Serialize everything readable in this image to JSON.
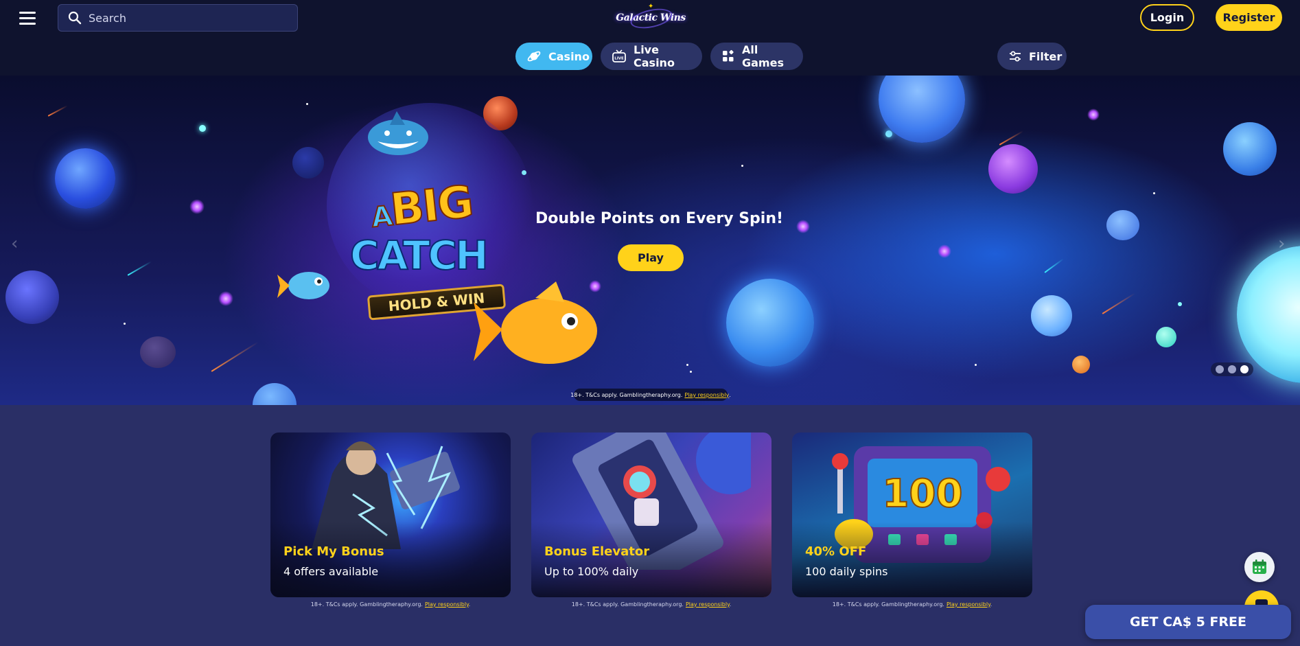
{
  "header": {
    "search_placeholder": "Search",
    "logo_text": "Galactic Wins",
    "login_label": "Login",
    "register_label": "Register"
  },
  "tabs": [
    {
      "label": "Casino",
      "icon": "planet-icon",
      "active": true
    },
    {
      "label": "Live Casino",
      "icon": "live-tv-icon",
      "active": false
    },
    {
      "label": "All Games",
      "icon": "grid-icon",
      "active": false
    }
  ],
  "filter_label": "Filter",
  "hero": {
    "game_logo_big": "BIG",
    "game_logo_a": "A",
    "game_logo_catch": "CATCH",
    "game_logo_hold": "HOLD & WIN",
    "title": "Double Points on Every Spin!",
    "play_label": "Play",
    "disclaimer": "18+. T&Cs apply. Gamblingtheraphy.org.",
    "disclaimer_link": "Play responsibly",
    "slides": 3,
    "active_slide": 3
  },
  "promos": [
    {
      "title": "Pick My Bonus",
      "subtitle": "4 offers available",
      "disclaimer": "18+. T&Cs apply. Gamblingtheraphy.org.",
      "disclaimer_link": "Play responsibly"
    },
    {
      "title": "Bonus Elevator",
      "subtitle": "Up to 100% daily",
      "disclaimer": "18+. T&Cs apply. Gamblingtheraphy.org.",
      "disclaimer_link": "Play responsibly"
    },
    {
      "title": "40% OFF",
      "subtitle": "100 daily spins",
      "disclaimer": "18+. T&Cs apply. Gamblingtheraphy.org.",
      "disclaimer_link": "Play responsibly",
      "art_text": "100"
    }
  ],
  "cta_label": "GET CA$ 5 FREE",
  "colors": {
    "header_bg": "#0f132e",
    "page_bg": "#2a2f66",
    "accent_yellow": "#ffd21a",
    "casino_tab": "#41b8f0",
    "tab_bg": "#2c3466",
    "cta_bg": "#3a4fa8"
  }
}
